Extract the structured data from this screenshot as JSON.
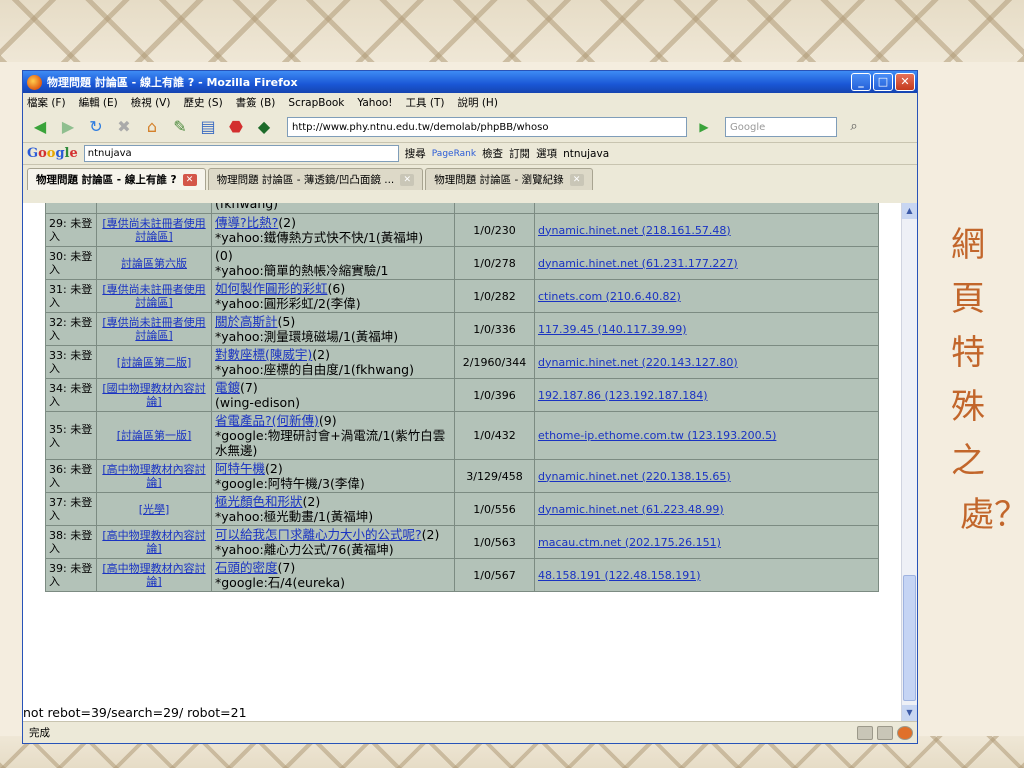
{
  "slide": {
    "caption_chars": [
      "網",
      "頁",
      "特",
      "殊",
      "之",
      "處？"
    ]
  },
  "window": {
    "title": "物理問題 討論區 - 線上有誰 ? - Mozilla Firefox"
  },
  "menu": [
    "檔案 (F)",
    "編輯 (E)",
    "檢視 (V)",
    "歷史 (S)",
    "書簽 (B)",
    "ScrapBook",
    "Yahoo!",
    "工具 (T)",
    "說明 (H)"
  ],
  "toolbar": {
    "url": "http://www.phy.ntnu.edu.tw/demolab/phpBB/whoso",
    "search_placeholder": "Google"
  },
  "googlebar": {
    "query": "ntnujava",
    "search_label": "搜尋",
    "pagerank_label": "PageRank",
    "check_label": "檢查",
    "subscribe_label": "訂閱",
    "options_label": "選項",
    "user_label": "ntnujava"
  },
  "tabs": [
    {
      "label": "物理問題 討論區 - 線上有誰 ?",
      "active": true
    },
    {
      "label": "物理問題 討論區 - 薄透鏡/凹凸面鏡 ...",
      "active": false
    },
    {
      "label": "物理問題 討論區 - 瀏覽紀錄",
      "active": false
    }
  ],
  "rows": [
    {
      "who": "29: 未登入",
      "forum": "[專供尚未註冊者使用討論區]",
      "topic": "傳導?比熱?",
      "count": "(2)",
      "last": "*yahoo:鐵傳熱方式快不快/1(黃福坤)",
      "stats": "1/0/230",
      "host": "dynamic.hinet.net (218.161.57.48)"
    },
    {
      "who": "30: 未登入",
      "forum": "討論區第六版",
      "topic": "",
      "count": "(0)",
      "last": "*yahoo:簡單的熱帳冷縮實驗/1",
      "stats": "1/0/278",
      "host": "dynamic.hinet.net (61.231.177.227)"
    },
    {
      "who": "31: 未登入",
      "forum": "[專供尚未註冊者使用討論區]",
      "topic": "如何製作圓形的彩虹",
      "count": "(6)",
      "last": "*yahoo:圓形彩虹/2(李偉)",
      "stats": "1/0/282",
      "host": "ctinets.com (210.6.40.82)"
    },
    {
      "who": "32: 未登入",
      "forum": "[專供尚未註冊者使用討論區]",
      "topic": "關於高斯計",
      "count": "(5)",
      "last": "*yahoo:測量環境磁場/1(黃福坤)",
      "stats": "1/0/336",
      "host": "117.39.45 (140.117.39.99)"
    },
    {
      "who": "33: 未登入",
      "forum": "[討論區第二版]",
      "topic": "對數座標(陳威宇)",
      "count": "(2)",
      "last": "*yahoo:座標的自由度/1(fkhwang)",
      "stats": "2/1960/344",
      "host": "dynamic.hinet.net (220.143.127.80)"
    },
    {
      "who": "34: 未登入",
      "forum": "[國中物理教材內容討論]",
      "topic": "電鍍",
      "count": "(7)",
      "last": "(wing-edison)",
      "stats": "1/0/396",
      "host": "192.187.86 (123.192.187.184)"
    },
    {
      "who": "35: 未登入",
      "forum": "[討論區第一版]",
      "topic": "省電產品?(何新傳)",
      "count": "(9)",
      "last": "*google:物理研討會+渦電流/1(紫竹白雲水無邊)",
      "stats": "1/0/432",
      "host": "ethome-ip.ethome.com.tw (123.193.200.5)"
    },
    {
      "who": "36: 未登入",
      "forum": "[高中物理教材內容討論]",
      "topic": "阿特午機",
      "count": "(2)",
      "last": "*google:阿特午機/3(李偉)",
      "stats": "3/129/458",
      "host": "dynamic.hinet.net (220.138.15.65)"
    },
    {
      "who": "37: 未登入",
      "forum": "[光學]",
      "topic": "極光顏色和形狀",
      "count": "(2)",
      "last": "*yahoo:極光動畫/1(黃福坤)",
      "stats": "1/0/556",
      "host": "dynamic.hinet.net (61.223.48.99)"
    },
    {
      "who": "38: 未登入",
      "forum": "[高中物理教材內容討論]",
      "topic": "可以給我怎ㄇ求離心力大小的公式呢?",
      "count": "(2)",
      "last": "*yahoo:離心力公式/76(黃福坤)",
      "stats": "1/0/563",
      "host": "macau.ctm.net (202.175.26.151)"
    },
    {
      "who": "39: 未登入",
      "forum": "[高中物理教材內容討論]",
      "topic": "石頭的密度",
      "count": "(7)",
      "last": "*google:石/4(eureka)",
      "stats": "1/0/567",
      "host": "48.158.191 (122.48.158.191)"
    }
  ],
  "partial_top_text": "(fkhwang)",
  "footer_text": "not rebot=39/search=29/ robot=21",
  "status": "完成"
}
